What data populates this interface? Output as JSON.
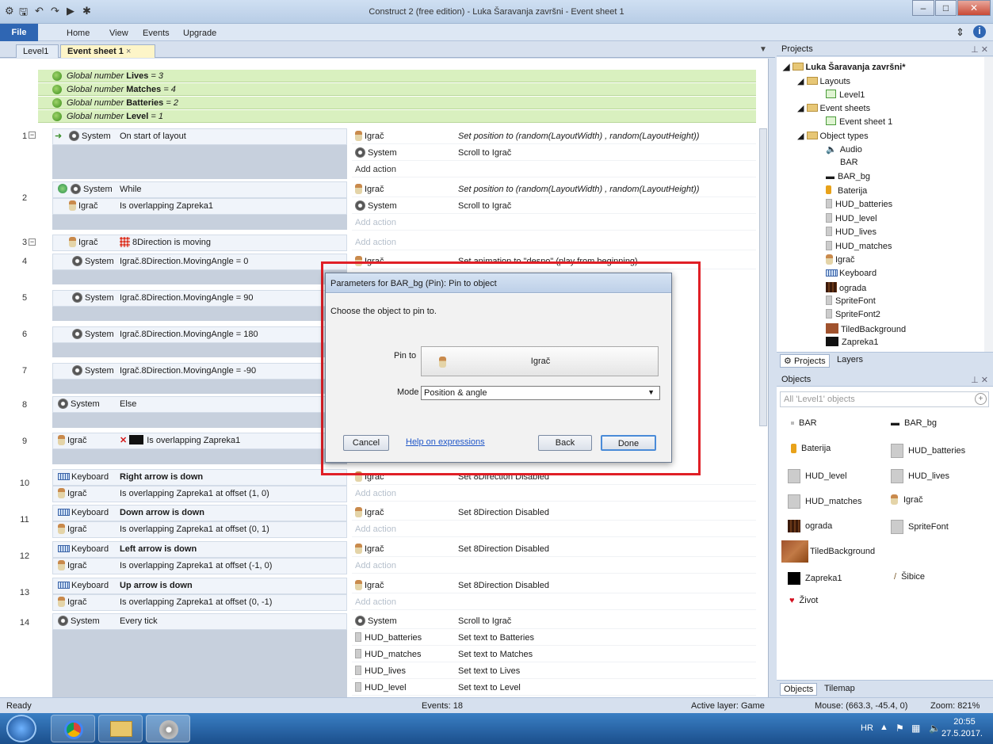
{
  "window": {
    "title": "Construct 2  (free edition) - Luka Šaravanja završni - Event sheet 1"
  },
  "menu": {
    "file": "File",
    "items": [
      "Home",
      "View",
      "Events",
      "Upgrade"
    ]
  },
  "tabs": [
    {
      "label": "Level1"
    },
    {
      "label": "Event sheet 1",
      "close": "×"
    }
  ],
  "globals": [
    {
      "prefix": "Global number",
      "name": "Lives",
      "value": "= 3"
    },
    {
      "prefix": "Global number",
      "name": "Matches",
      "value": "= 4"
    },
    {
      "prefix": "Global number",
      "name": "Batteries",
      "value": "= 2"
    },
    {
      "prefix": "Global number",
      "name": "Level",
      "value": "= 1"
    }
  ],
  "events": [
    {
      "num": "1",
      "obj": "System",
      "cond": "On start of layout",
      "actions": [
        [
          "Igrač",
          "Set position to (random(LayoutWidth) , random(LayoutHeight))"
        ],
        [
          "System",
          "Scroll to Igrač"
        ],
        [
          "Add action",
          ""
        ]
      ]
    },
    {
      "num": "2",
      "obj": "System",
      "cond": "While",
      "obj2": "Igrač",
      "cond2": "Is overlapping Zapreka1",
      "actions": [
        [
          "Igrač",
          "Set position to (random(LayoutWidth) , random(LayoutHeight))"
        ],
        [
          "System",
          "Scroll to Igrač"
        ],
        [
          "Add action",
          ""
        ]
      ]
    },
    {
      "num": "3",
      "obj": "Igrač",
      "cond": "8Direction is moving",
      "actions": [
        [
          "Add action",
          ""
        ]
      ]
    },
    {
      "num": "4",
      "obj": "System",
      "cond": "Igrač.8Direction.MovingAngle = 0",
      "actions": [
        [
          "Igrač",
          "Set animation to \"desno\" (play from beginning)"
        ]
      ]
    },
    {
      "num": "5",
      "obj": "System",
      "cond": "Igrač.8Direction.MovingAngle = 90",
      "actions": []
    },
    {
      "num": "6",
      "obj": "System",
      "cond": "Igrač.8Direction.MovingAngle = 180",
      "actions": []
    },
    {
      "num": "7",
      "obj": "System",
      "cond": "Igrač.8Direction.MovingAngle = -90",
      "actions": []
    },
    {
      "num": "8",
      "obj": "System",
      "cond": "Else",
      "actions": []
    },
    {
      "num": "9",
      "obj": "Igrač",
      "cond": "Is overlapping Zapreka1",
      "actions": []
    },
    {
      "num": "10",
      "obj": "Keyboard",
      "cond": "Right arrow is down",
      "obj2": "Igrač",
      "cond2": "Is overlapping Zapreka1 at offset (1, 0)",
      "actions": [
        [
          "Igrač",
          "Set 8Direction Disabled"
        ],
        [
          "Add action",
          ""
        ]
      ]
    },
    {
      "num": "11",
      "obj": "Keyboard",
      "cond": "Down arrow is down",
      "obj2": "Igrač",
      "cond2": "Is overlapping Zapreka1 at offset (0, 1)",
      "actions": [
        [
          "Igrač",
          "Set 8Direction Disabled"
        ],
        [
          "Add action",
          ""
        ]
      ]
    },
    {
      "num": "12",
      "obj": "Keyboard",
      "cond": "Left arrow is down",
      "obj2": "Igrač",
      "cond2": "Is overlapping Zapreka1 at offset (-1, 0)",
      "actions": [
        [
          "Igrač",
          "Set 8Direction Disabled"
        ],
        [
          "Add action",
          ""
        ]
      ]
    },
    {
      "num": "13",
      "obj": "Keyboard",
      "cond": "Up arrow is down",
      "obj2": "Igrač",
      "cond2": "Is overlapping Zapreka1 at offset (0, -1)",
      "actions": [
        [
          "Igrač",
          "Set 8Direction Disabled"
        ],
        [
          "Add action",
          ""
        ]
      ]
    },
    {
      "num": "14",
      "obj": "System",
      "cond": "Every tick",
      "actions": [
        [
          "System",
          "Scroll to Igrač"
        ],
        [
          "HUD_batteries",
          "Set text to Batteries"
        ],
        [
          "HUD_matches",
          "Set text to Matches"
        ],
        [
          "HUD_lives",
          "Set text to Lives"
        ],
        [
          "HUD_level",
          "Set text to Level"
        ]
      ]
    }
  ],
  "projects": {
    "header": "Projects",
    "root": "Luka Šaravanja završni*",
    "layouts_label": "Layouts",
    "layout1": "Level1",
    "eventsheets_label": "Event sheets",
    "sheet1": "Event sheet 1",
    "objtypes_label": "Object types",
    "object_types": [
      "Audio",
      "BAR",
      "BAR_bg",
      "Baterija",
      "HUD_batteries",
      "HUD_level",
      "HUD_lives",
      "HUD_matches",
      "Igrač",
      "Keyboard",
      "ograda",
      "SpriteFont",
      "SpriteFont2",
      "TiledBackground",
      "Zapreka1"
    ],
    "tab_projects": "Projects",
    "tab_layers": "Layers"
  },
  "objects": {
    "header": "Objects",
    "search_placeholder": "All 'Level1' objects",
    "items": [
      "BAR",
      "BAR_bg",
      "Baterija",
      "HUD_batteries",
      "HUD_level",
      "HUD_lives",
      "HUD_matches",
      "Igrač",
      "ograda",
      "SpriteFont",
      "TiledBackground",
      "Zapreka1",
      "Šibice",
      "Život"
    ],
    "tab_objects": "Objects",
    "tab_tilemap": "Tilemap"
  },
  "status": {
    "ready": "Ready",
    "events": "Events: 18",
    "layer": "Active layer: Game",
    "mouse": "Mouse: (663.3, -45.4, 0)",
    "zoom": "Zoom: 821%"
  },
  "taskbar": {
    "lang": "HR",
    "time": "20:55",
    "date": "27.5.2017."
  },
  "dialog": {
    "title": "Parameters for BAR_bg (Pin): Pin to object",
    "prompt": "Choose the object to pin to.",
    "pinto_label": "Pin to",
    "pinto_value": "Igrač",
    "mode_label": "Mode",
    "mode_value": "Position & angle",
    "cancel": "Cancel",
    "help": "Help on expressions",
    "back": "Back",
    "done": "Done"
  },
  "colors": {
    "accent": "#2f66b3",
    "highlight_frame": "#e01f26",
    "global_bg": "#d9f0bf"
  }
}
